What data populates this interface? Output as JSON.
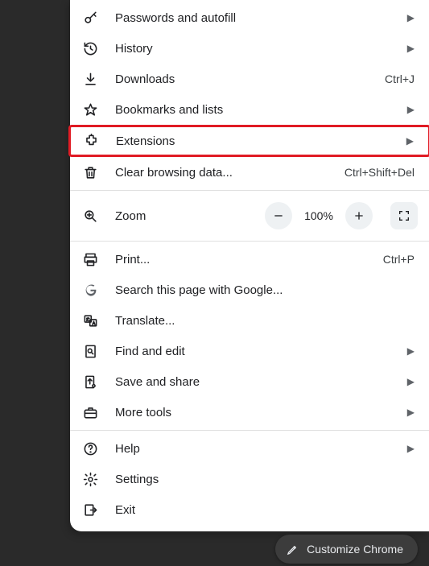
{
  "menu": {
    "groups": [
      [
        {
          "icon": "key-icon",
          "label": "Passwords and autofill",
          "shortcut": "",
          "submenu": true
        },
        {
          "icon": "history-icon",
          "label": "History",
          "shortcut": "",
          "submenu": true
        },
        {
          "icon": "download-icon",
          "label": "Downloads",
          "shortcut": "Ctrl+J",
          "submenu": false
        },
        {
          "icon": "star-icon",
          "label": "Bookmarks and lists",
          "shortcut": "",
          "submenu": true
        },
        {
          "icon": "extension-icon",
          "label": "Extensions",
          "shortcut": "",
          "submenu": true,
          "highlight": true
        },
        {
          "icon": "trash-icon",
          "label": "Clear browsing data...",
          "shortcut": "Ctrl+Shift+Del",
          "submenu": false
        }
      ],
      [
        {
          "zoom": true,
          "icon": "zoom-icon",
          "label": "Zoom",
          "value": "100%"
        }
      ],
      [
        {
          "icon": "print-icon",
          "label": "Print...",
          "shortcut": "Ctrl+P",
          "submenu": false
        },
        {
          "icon": "google-icon",
          "label": "Search this page with Google...",
          "shortcut": "",
          "submenu": false
        },
        {
          "icon": "translate-icon",
          "label": "Translate...",
          "shortcut": "",
          "submenu": false
        },
        {
          "icon": "find-icon",
          "label": "Find and edit",
          "shortcut": "",
          "submenu": true
        },
        {
          "icon": "share-icon",
          "label": "Save and share",
          "shortcut": "",
          "submenu": true
        },
        {
          "icon": "toolbox-icon",
          "label": "More tools",
          "shortcut": "",
          "submenu": true
        }
      ],
      [
        {
          "icon": "help-icon",
          "label": "Help",
          "shortcut": "",
          "submenu": true
        },
        {
          "icon": "settings-icon",
          "label": "Settings",
          "shortcut": "",
          "submenu": false
        },
        {
          "icon": "exit-icon",
          "label": "Exit",
          "shortcut": "",
          "submenu": false
        }
      ]
    ]
  },
  "customize_label": "Customize Chrome"
}
